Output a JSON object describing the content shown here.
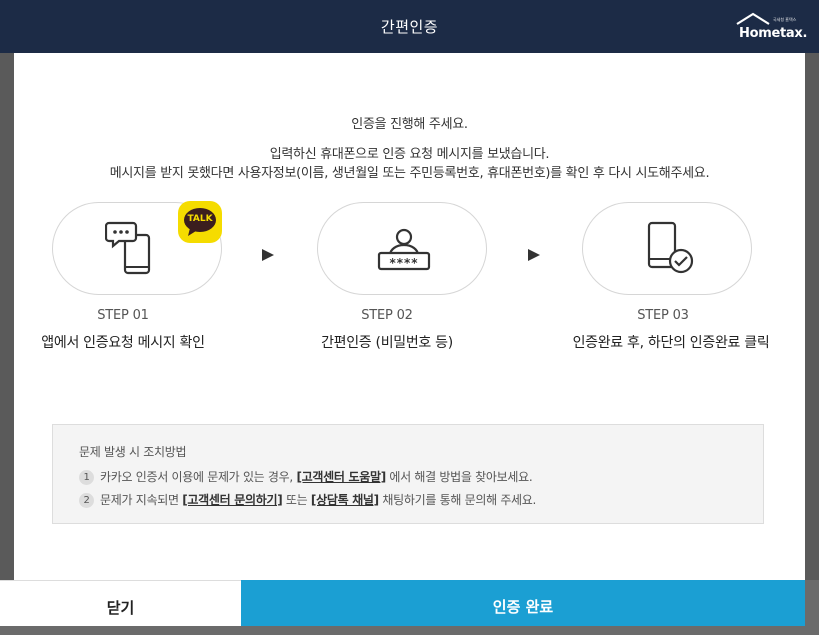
{
  "header": {
    "title": "간편인증",
    "logo_text": "Hometax.",
    "logo_sub": "국세청 홈택스"
  },
  "messages": {
    "line1": "인증을 진행해 주세요.",
    "line2": "입력하신 휴대폰으로 인증 요청 메시지를 보냈습니다.",
    "line3": "메시지를 받지 못했다면 사용자정보(이름, 생년월일 또는 주민등록번호, 휴대폰번호)를 확인 후 다시 시도해주세요."
  },
  "steps": [
    {
      "num": "STEP 01",
      "desc": "앱에서 인증요청 메시지 확인",
      "icon": "phone-chat-icon",
      "badge": "TALK"
    },
    {
      "num": "STEP 02",
      "desc": "간편인증 (비밀번호 등)",
      "icon": "password-user-icon",
      "code": "****"
    },
    {
      "num": "STEP 03",
      "desc": "인증완료 후, 하단의 인증완료 클릭",
      "icon": "phone-check-icon"
    }
  ],
  "trouble": {
    "title": "문제 발생 시 조치방법",
    "items": [
      {
        "num": "1",
        "pre": "카카오 인증서 이용에 문제가 있는 경우,",
        "link1": "[고객센터 도움말]",
        "mid": "에서 해결 방법을 찾아보세요."
      },
      {
        "num": "2",
        "pre": "문제가 지속되면",
        "link1": "[고객센터 문의하기]",
        "mid": "또는",
        "link2": "[상담톡 채널]",
        "post": "채팅하기를 통해 문의해 주세요."
      }
    ]
  },
  "buttons": {
    "close": "닫기",
    "confirm": "인증 완료"
  },
  "colors": {
    "header": "#1c2b46",
    "confirm": "#1b9fd3",
    "talk_badge": "#f5dc00"
  }
}
